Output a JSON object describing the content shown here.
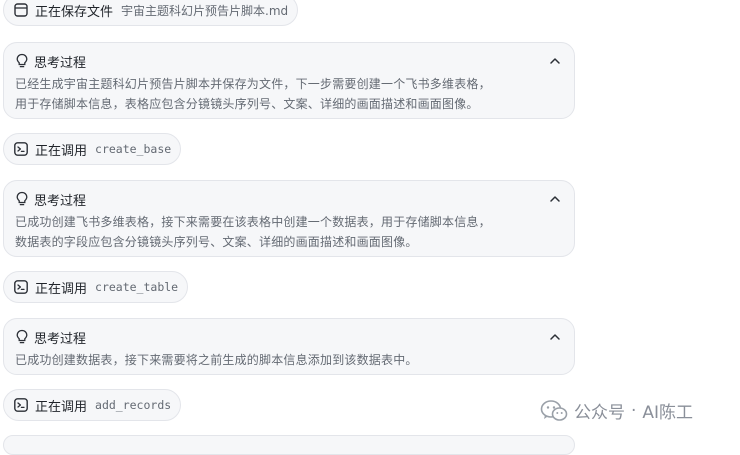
{
  "steps": [
    {
      "kind": "tool",
      "action": "正在保存文件",
      "target": "宇宙主题科幻片预告片脚本.md"
    },
    {
      "kind": "thought",
      "title": "思考过程",
      "lines": [
        "已经生成宇宙主题科幻片预告片脚本并保存为文件，下一步需要创建一个飞书多维表格，",
        "用于存储脚本信息，表格应包含分镜镜头序列号、文案、详细的画面描述和画面图像。"
      ]
    },
    {
      "kind": "tool",
      "action": "正在调用",
      "target": "create_base"
    },
    {
      "kind": "thought",
      "title": "思考过程",
      "lines": [
        "已成功创建飞书多维表格，接下来需要在该表格中创建一个数据表，用于存储脚本信息，",
        "数据表的字段应包含分镜镜头序列号、文案、详细的画面描述和画面图像。"
      ]
    },
    {
      "kind": "tool",
      "action": "正在调用",
      "target": "create_table"
    },
    {
      "kind": "thought",
      "title": "思考过程",
      "lines": [
        "已成功创建数据表，接下来需要将之前生成的脚本信息添加到该数据表中。"
      ]
    },
    {
      "kind": "tool",
      "action": "正在调用",
      "target": "add_records"
    }
  ],
  "watermark": {
    "channel_label": "公众号",
    "separator": "·",
    "author": "AI陈工"
  },
  "icons": {
    "tool": "terminal-icon",
    "file": "file-icon",
    "thought": "lightbulb-icon",
    "collapse": "chevron-up-icon",
    "watermark": "wechat-icon"
  }
}
